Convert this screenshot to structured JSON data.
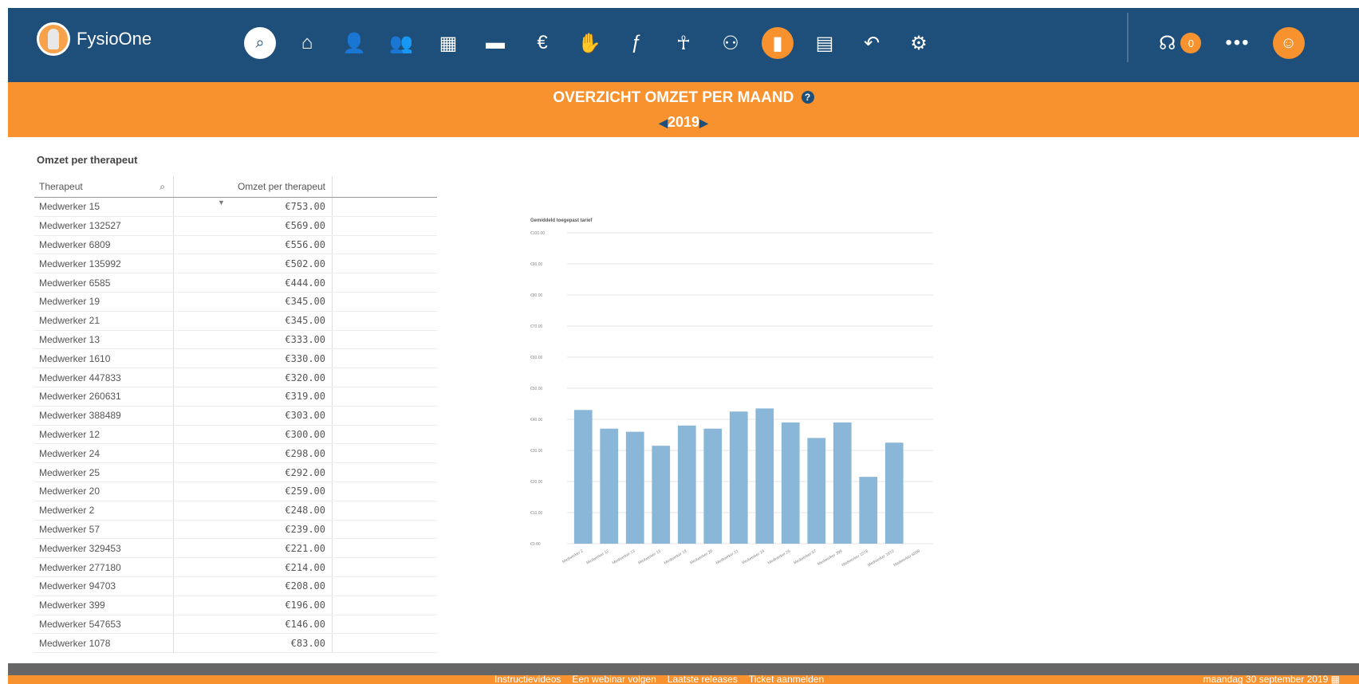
{
  "app": {
    "name": "FysioOne"
  },
  "nav": [
    {
      "name": "search-icon",
      "glyph": "⌕"
    },
    {
      "name": "home-icon",
      "glyph": "⌂"
    },
    {
      "name": "user-add-icon",
      "glyph": "👤"
    },
    {
      "name": "users-icon",
      "glyph": "👥"
    },
    {
      "name": "calendar-icon",
      "glyph": "▦"
    },
    {
      "name": "folder-icon",
      "glyph": "▬"
    },
    {
      "name": "money-icon",
      "glyph": "€"
    },
    {
      "name": "handshake-icon",
      "glyph": "✋"
    },
    {
      "name": "exercise-icon",
      "glyph": "ƒ"
    },
    {
      "name": "body-icon",
      "glyph": "☥"
    },
    {
      "name": "organization-icon",
      "glyph": "⚇"
    },
    {
      "name": "reports-icon",
      "glyph": "▮"
    },
    {
      "name": "address-book-icon",
      "glyph": "▤"
    },
    {
      "name": "reply-icon",
      "glyph": "↶"
    },
    {
      "name": "settings-icon",
      "glyph": "⚙"
    }
  ],
  "notifications": {
    "count": "0"
  },
  "page": {
    "title": "OVERZICHT OMZET PER MAAND",
    "help": "?",
    "year": "2019"
  },
  "table": {
    "title": "Omzet per therapeut",
    "headers": [
      "Therapeut",
      "Omzet per therapeut"
    ],
    "rows": [
      [
        "Medwerker 15",
        "€753.00"
      ],
      [
        "Medwerker 132527",
        "€569.00"
      ],
      [
        "Medwerker 6809",
        "€556.00"
      ],
      [
        "Medwerker 135992",
        "€502.00"
      ],
      [
        "Medwerker 6585",
        "€444.00"
      ],
      [
        "Medwerker 19",
        "€345.00"
      ],
      [
        "Medwerker 21",
        "€345.00"
      ],
      [
        "Medwerker 13",
        "€333.00"
      ],
      [
        "Medwerker 1610",
        "€330.00"
      ],
      [
        "Medwerker 447833",
        "€320.00"
      ],
      [
        "Medwerker 260631",
        "€319.00"
      ],
      [
        "Medwerker 388489",
        "€303.00"
      ],
      [
        "Medwerker 12",
        "€300.00"
      ],
      [
        "Medwerker 24",
        "€298.00"
      ],
      [
        "Medwerker 25",
        "€292.00"
      ],
      [
        "Medwerker 20",
        "€259.00"
      ],
      [
        "Medwerker 2",
        "€248.00"
      ],
      [
        "Medwerker 57",
        "€239.00"
      ],
      [
        "Medwerker 329453",
        "€221.00"
      ],
      [
        "Medwerker 277180",
        "€214.00"
      ],
      [
        "Medwerker 94703",
        "€208.00"
      ],
      [
        "Medwerker 399",
        "€196.00"
      ],
      [
        "Medwerker 547653",
        "€146.00"
      ],
      [
        "Medwerker 1078",
        "€83.00"
      ]
    ]
  },
  "chart_data": {
    "type": "bar",
    "title": "Gemiddeld toegepast tarief",
    "ylim": [
      0,
      100
    ],
    "yticks": [
      "€0.00",
      "€10.00",
      "€20.00",
      "€30.00",
      "€40.00",
      "€50.00",
      "€60.00",
      "€70.00",
      "€80.00",
      "€90.00",
      "€100.00"
    ],
    "categories": [
      "Medwerker 2",
      "Medwerker 12",
      "Medwerker 13",
      "Medwerker 15",
      "Medwerker 19",
      "Medwerker 20",
      "Medwerker 21",
      "Medwerker 24",
      "Medwerker 25",
      "Medwerker 57",
      "Medwerker 399",
      "Medwerker 1078",
      "Medwerker 1610",
      "Medwerker 6809"
    ],
    "values": [
      43,
      37,
      36,
      31.5,
      38,
      37,
      42.5,
      43.5,
      39,
      34,
      39,
      21.5,
      32.5,
      0
    ],
    "bar_color": "#8ab6d8"
  },
  "footer": {
    "links": [
      "Instructievideos",
      "Een webinar volgen",
      "Laatste releases",
      "Ticket aanmelden"
    ],
    "date": "maandag 30 september 2019"
  }
}
